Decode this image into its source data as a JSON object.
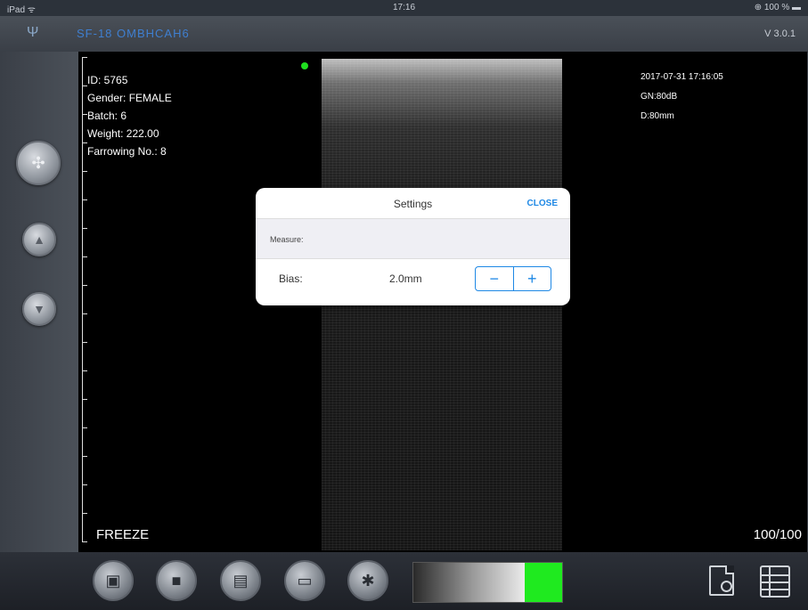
{
  "statusbar": {
    "left": "iPad ᯤ",
    "time": "17:16",
    "right": "⊕ 100 % ▬"
  },
  "appbar": {
    "title": "SF-18 OMBHCAH6",
    "version": "V 3.0.1"
  },
  "patient": {
    "id": "ID: 5765",
    "gender": "Gender: FEMALE",
    "batch": "Batch: 6",
    "weight": "Weight: 222.00",
    "farrowing": "Farrowing No.: 8"
  },
  "scan_info": {
    "datetime": "2017-07-31 17:16:05",
    "gain": "GN:80dB",
    "depth": "D:80mm"
  },
  "freeze_label": "FREEZE",
  "frame_counter": "100/100",
  "dialog": {
    "title": "Settings",
    "close": "CLOSE",
    "section": "Measure:",
    "bias_label": "Bias:",
    "bias_value": "2.0mm",
    "minus": "−",
    "plus": "+"
  },
  "icons": {
    "joystick": "✣",
    "up": "▲",
    "down": "▼",
    "image": "▣",
    "video": "■",
    "save": "▤",
    "measure": "▭",
    "settings": "✱"
  },
  "colors": {
    "accent": "#1e88e5",
    "indicator": "#1fe01f",
    "gain_fill": "#1fea1f"
  }
}
